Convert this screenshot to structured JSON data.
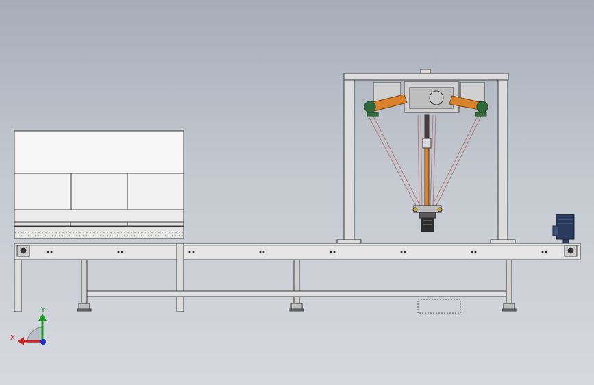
{
  "viewport": {
    "view_name": "cad-front-view",
    "background_top": "#a6adb8",
    "background_bottom": "#d6d9de"
  },
  "triad": {
    "x_label": "X",
    "y_label": "Y",
    "x_color": "#d42020",
    "y_color": "#1e9b2a",
    "z_color": "#1c2fd0"
  },
  "model": {
    "components": [
      "conveyor-frame",
      "feed-hood",
      "delta-robot-gantry",
      "delta-robot",
      "drive-motor"
    ],
    "colors": {
      "steel": "#d9d9d9",
      "outline": "#3a3a3a",
      "orange_arm": "#d9822b",
      "green_joint": "#2f6b3a",
      "motor_blue": "#2a3a5c",
      "hood_white": "#f7f7f7"
    }
  }
}
